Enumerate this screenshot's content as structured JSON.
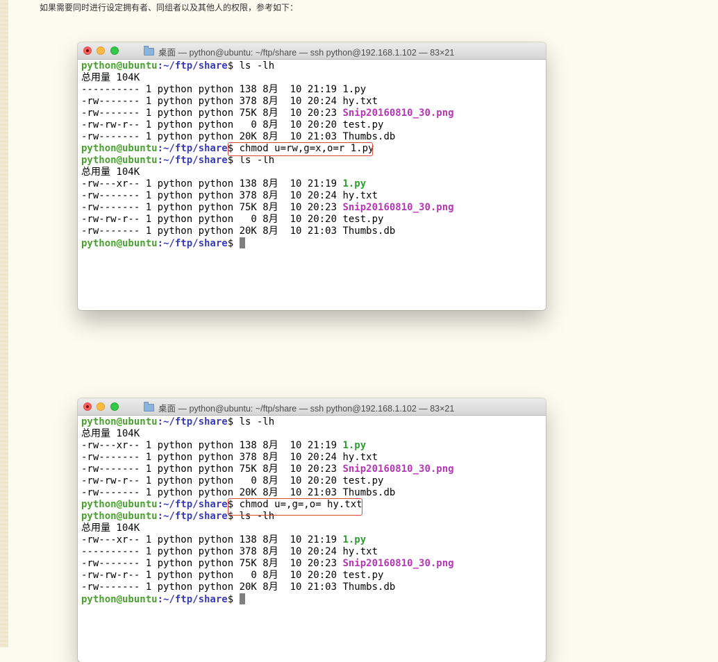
{
  "intro_text": "如果需要同时进行设定拥有者、同组者以及其他人的权限，参考如下：",
  "window_title": "桌面 — python@ubuntu: ~/ftp/share — ssh python@192.168.1.102 — 83×21",
  "prompt": {
    "user_host": "python@ubuntu",
    "path": ":~/ftp/share",
    "symbol": "$ "
  },
  "terminal1": {
    "lines": [
      {
        "type": "prompt",
        "cmd": "ls -lh"
      },
      {
        "type": "text",
        "text": "总用量 104K"
      },
      {
        "type": "file",
        "prefix": "---------- 1 python python 138 8月  10 21:19 ",
        "name": "1.py",
        "color": ""
      },
      {
        "type": "file",
        "prefix": "-rw------- 1 python python 378 8月  10 20:24 ",
        "name": "hy.txt",
        "color": ""
      },
      {
        "type": "file",
        "prefix": "-rw------- 1 python python 75K 8月  10 20:23 ",
        "name": "Snip20160810_30.png",
        "color": "magenta"
      },
      {
        "type": "file",
        "prefix": "-rw-rw-r-- 1 python python   0 8月  10 20:20 ",
        "name": "test.py",
        "color": ""
      },
      {
        "type": "file",
        "prefix": "-rw------- 1 python python 20K 8月  10 21:03 ",
        "name": "Thumbs.db",
        "color": ""
      },
      {
        "type": "prompt",
        "cmd": "chmod u=rw,g=x,o=r 1.py",
        "highlight": true
      },
      {
        "type": "prompt",
        "cmd": "ls -lh"
      },
      {
        "type": "text",
        "text": "总用量 104K"
      },
      {
        "type": "file",
        "prefix": "-rw---xr-- 1 python python 138 8月  10 21:19 ",
        "name": "1.py",
        "color": "green"
      },
      {
        "type": "file",
        "prefix": "-rw------- 1 python python 378 8月  10 20:24 ",
        "name": "hy.txt",
        "color": ""
      },
      {
        "type": "file",
        "prefix": "-rw------- 1 python python 75K 8月  10 20:23 ",
        "name": "Snip20160810_30.png",
        "color": "magenta"
      },
      {
        "type": "file",
        "prefix": "-rw-rw-r-- 1 python python   0 8月  10 20:20 ",
        "name": "test.py",
        "color": ""
      },
      {
        "type": "file",
        "prefix": "-rw------- 1 python python 20K 8月  10 21:03 ",
        "name": "Thumbs.db",
        "color": ""
      },
      {
        "type": "prompt",
        "cmd": "",
        "cursor": true
      }
    ]
  },
  "terminal2": {
    "lines": [
      {
        "type": "prompt",
        "cmd": "ls -lh"
      },
      {
        "type": "text",
        "text": "总用量 104K"
      },
      {
        "type": "file",
        "prefix": "-rw---xr-- 1 python python 138 8月  10 21:19 ",
        "name": "1.py",
        "color": "green"
      },
      {
        "type": "file",
        "prefix": "-rw------- 1 python python 378 8月  10 20:24 ",
        "name": "hy.txt",
        "color": ""
      },
      {
        "type": "file",
        "prefix": "-rw------- 1 python python 75K 8月  10 20:23 ",
        "name": "Snip20160810_30.png",
        "color": "magenta"
      },
      {
        "type": "file",
        "prefix": "-rw-rw-r-- 1 python python   0 8月  10 20:20 ",
        "name": "test.py",
        "color": ""
      },
      {
        "type": "file",
        "prefix": "-rw------- 1 python python 20K 8月  10 21:03 ",
        "name": "Thumbs.db",
        "color": ""
      },
      {
        "type": "prompt",
        "cmd": "chmod u=,g=,o= hy.txt",
        "highlight": true
      },
      {
        "type": "prompt",
        "cmd": "ls -lh"
      },
      {
        "type": "text",
        "text": "总用量 104K"
      },
      {
        "type": "file",
        "prefix": "-rw---xr-- 1 python python 138 8月  10 21:19 ",
        "name": "1.py",
        "color": "green"
      },
      {
        "type": "file",
        "prefix": "---------- 1 python python 378 8月  10 20:24 ",
        "name": "hy.txt",
        "color": ""
      },
      {
        "type": "file",
        "prefix": "-rw------- 1 python python 75K 8月  10 20:23 ",
        "name": "Snip20160810_30.png",
        "color": "magenta"
      },
      {
        "type": "file",
        "prefix": "-rw-rw-r-- 1 python python   0 8月  10 20:20 ",
        "name": "test.py",
        "color": ""
      },
      {
        "type": "file",
        "prefix": "-rw------- 1 python python 20K 8月  10 21:03 ",
        "name": "Thumbs.db",
        "color": ""
      },
      {
        "type": "prompt",
        "cmd": "",
        "cursor": true
      }
    ]
  },
  "colors": {
    "prompt_user": "#4aa031",
    "prompt_path": "#3b3bb8",
    "exec_file": "#2e9e2e",
    "image_file": "#b437b4",
    "highlight_box": "#d9463a"
  }
}
